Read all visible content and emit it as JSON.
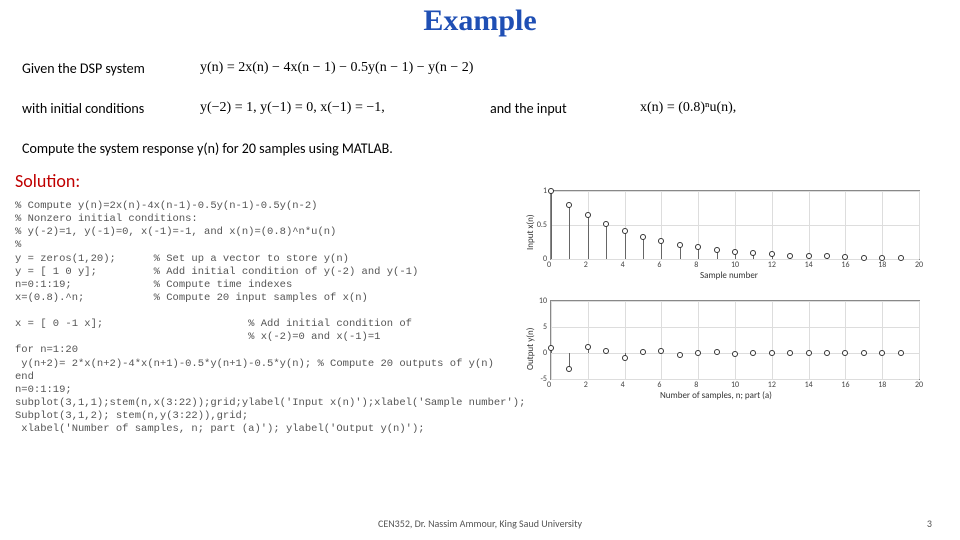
{
  "title": "Example",
  "text": {
    "given": "Given the DSP system",
    "system_eq": "y(n) = 2x(n) − 4x(n − 1) − 0.5y(n − 1) − y(n − 2)",
    "with_ic": "with initial conditions",
    "ic_eq": "y(−2) = 1, y(−1) = 0, x(−1) = −1,",
    "and_input": "and the input",
    "input_eq": "x(n) = (0.8)ⁿu(n),",
    "instruction": "Compute the system response y(n)  for 20 samples using MATLAB.",
    "solution": "Solution:"
  },
  "code": "% Compute y(n)=2x(n)-4x(n-1)-0.5y(n-1)-0.5y(n-2)\n% Nonzero initial conditions:\n% y(-2)=1, y(-1)=0, x(-1)=-1, and x(n)=(0.8)^n*u(n)\n%\ny = zeros(1,20);      % Set up a vector to store y(n)\ny = [ 1 0 y];         % Add initial condition of y(-2) and y(-1)\nn=0:1:19;             % Compute time indexes\nx=(0.8).^n;           % Compute 20 input samples of x(n)\n\nx = [ 0 -1 x];                       % Add initial condition of\n                                     % x(-2)=0 and x(-1)=1\nfor n=1:20\n y(n+2)= 2*x(n+2)-4*x(n+1)-0.5*y(n+1)-0.5*y(n); % Compute 20 outputs of y(n)\nend\nn=0:1:19;\nsubplot(3,1,1);stem(n,x(3:22));grid;ylabel('Input x(n)');xlabel('Sample number');\nSubplot(3,1,2); stem(n,y(3:22)),grid;\n xlabel('Number of samples, n; part (a)'); ylabel('Output y(n)');",
  "footer": {
    "center": "CEN352, Dr. Nassim Ammour, King Saud University",
    "page": "3"
  },
  "chart_data": [
    {
      "type": "stem",
      "title": "",
      "ylabel": "Input x(n)",
      "xlabel": "Sample number",
      "xlim": [
        0,
        20
      ],
      "ylim": [
        0,
        1
      ],
      "xticks": [
        0,
        2,
        4,
        6,
        8,
        10,
        12,
        14,
        16,
        18,
        20
      ],
      "yticks": [
        0,
        0.5,
        1
      ],
      "x": [
        0,
        1,
        2,
        3,
        4,
        5,
        6,
        7,
        8,
        9,
        10,
        11,
        12,
        13,
        14,
        15,
        16,
        17,
        18,
        19
      ],
      "y": [
        1.0,
        0.8,
        0.64,
        0.51,
        0.41,
        0.33,
        0.26,
        0.21,
        0.17,
        0.13,
        0.11,
        0.09,
        0.07,
        0.05,
        0.04,
        0.04,
        0.03,
        0.02,
        0.02,
        0.01
      ]
    },
    {
      "type": "stem",
      "title": "",
      "ylabel": "Output y(n)",
      "xlabel": "Number of samples, n; part (a)",
      "xlim": [
        0,
        20
      ],
      "ylim": [
        -5,
        10
      ],
      "xticks": [
        0,
        2,
        4,
        6,
        8,
        10,
        12,
        14,
        16,
        18,
        20
      ],
      "yticks": [
        -5,
        0,
        5,
        10
      ],
      "x": [
        0,
        1,
        2,
        3,
        4,
        5,
        6,
        7,
        8,
        9,
        10,
        11,
        12,
        13,
        14,
        15,
        16,
        17,
        18,
        19
      ],
      "y": [
        1.0,
        -3.0,
        1.22,
        0.33,
        -0.9,
        0.12,
        0.3,
        -0.31,
        -0.01,
        0.13,
        -0.11,
        -0.02,
        0.06,
        -0.04,
        -0.02,
        0.03,
        -0.01,
        -0.01,
        0.01,
        0.0
      ]
    }
  ]
}
